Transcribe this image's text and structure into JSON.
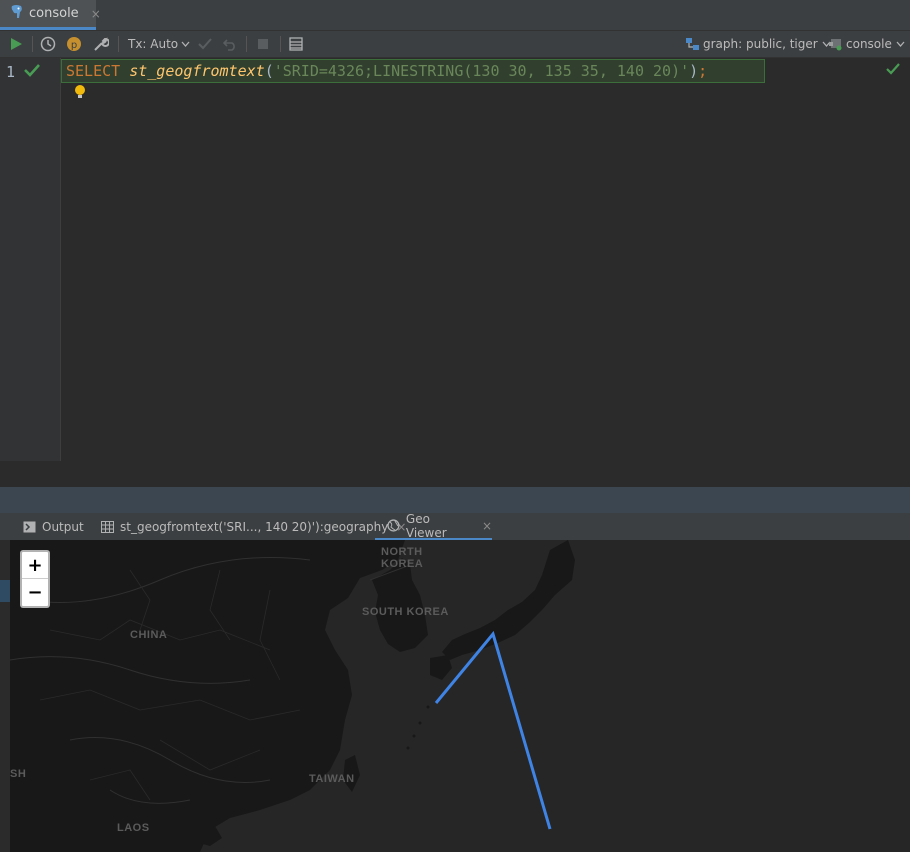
{
  "tabs": {
    "console_tab": {
      "label": "console",
      "close": "×"
    }
  },
  "toolbar": {
    "tx_label": "Tx: Auto",
    "schema_label": "graph: public, tiger",
    "console_label": "console"
  },
  "editor": {
    "line_number": "1",
    "code": {
      "keyword": "SELECT",
      "function": "st_geogfromtext",
      "open_paren": "(",
      "string": "'SRID=4326;LINESTRING(130 30, 135 35, 140 20)'",
      "close_paren": ")",
      "semicolon": ";"
    }
  },
  "results": {
    "tabs": [
      {
        "label": "Output"
      },
      {
        "label": "st_geogfromtext('SRI..., 140 20)'):geography",
        "close": "×"
      },
      {
        "label": "Geo Viewer",
        "close": "×"
      }
    ]
  },
  "map": {
    "zoom_in": "+",
    "zoom_out": "−",
    "labels": {
      "north_korea_1": "NORTH",
      "north_korea_2": "KOREA",
      "south_korea": "SOUTH KOREA",
      "china": "CHINA",
      "taiwan": "TAIWAN",
      "laos": "LAOS",
      "bangladesh_partial": "SH"
    },
    "linestring_color": "#3f84e5",
    "linestring_points": [
      [
        130,
        30
      ],
      [
        135,
        35
      ],
      [
        140,
        20
      ]
    ]
  },
  "colors": {
    "keyword": "#cc7832",
    "function": "#ffc66d",
    "string": "#6a8759",
    "run_green": "#499c54",
    "accent_blue": "#4a88c7"
  }
}
